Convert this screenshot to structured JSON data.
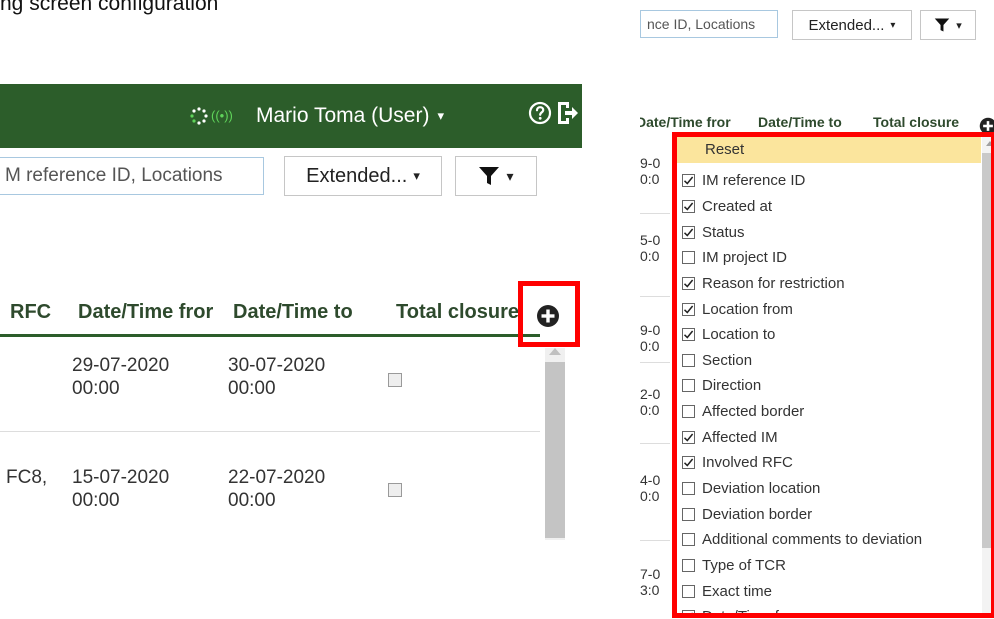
{
  "caption": "ng screen configuration",
  "header": {
    "user_label": "Mario Toma (User)",
    "caret": "▾"
  },
  "search": {
    "left_visible_text": "M reference ID, Locations",
    "right_visible_text": "nce ID, Locations"
  },
  "toolbar": {
    "extended_label": "Extended...",
    "caret": "▾"
  },
  "table": {
    "headers": [
      "RFC",
      "Date/Time fror",
      "Date/Time to",
      "Total closure"
    ],
    "right_headers": [
      "Date/Time fror",
      "Date/Time to",
      "Total closure"
    ],
    "rows": [
      {
        "rfc": "",
        "date_from": "29-07-2020\n00:00",
        "date_to": "30-07-2020\n00:00",
        "total_closure": false
      },
      {
        "rfc": "FC8,",
        "date_from": "15-07-2020\n00:00",
        "date_to": "22-07-2020\n00:00",
        "total_closure": false
      }
    ],
    "right_edge_dates": [
      "9-0\n0:0",
      "5-0\n0:0",
      "9-0\n0:0",
      "2-0\n0:0",
      "4-0\n0:0",
      "7-0\n3:0"
    ]
  },
  "column_picker": {
    "reset_label": "Reset",
    "columns": [
      {
        "label": "IM reference ID",
        "checked": true
      },
      {
        "label": "Created at",
        "checked": true
      },
      {
        "label": "Status",
        "checked": true
      },
      {
        "label": "IM project ID",
        "checked": false
      },
      {
        "label": "Reason for restriction",
        "checked": true
      },
      {
        "label": "Location from",
        "checked": true
      },
      {
        "label": "Location to",
        "checked": true
      },
      {
        "label": "Section",
        "checked": false
      },
      {
        "label": "Direction",
        "checked": false
      },
      {
        "label": "Affected border",
        "checked": false
      },
      {
        "label": "Affected IM",
        "checked": true
      },
      {
        "label": "Involved RFC",
        "checked": true
      },
      {
        "label": "Deviation location",
        "checked": false
      },
      {
        "label": "Deviation border",
        "checked": false
      },
      {
        "label": "Additional comments to deviation",
        "checked": false
      },
      {
        "label": "Type of TCR",
        "checked": false
      },
      {
        "label": "Exact time",
        "checked": false
      },
      {
        "label": "Date/Time from",
        "checked": true
      }
    ]
  },
  "icons": {
    "loading": "loading-spinner-icon",
    "signal": "signal-icon",
    "help": "help-circle-icon",
    "logout": "logout-icon",
    "filter": "filter-icon",
    "add_column": "plus-circle-icon"
  },
  "colors": {
    "topbar": "#2c5d2a",
    "header_text": "#2e4a2d",
    "signal": "#5fd35a",
    "highlight": "#ff0000",
    "reset_bg": "#fbe59d"
  }
}
